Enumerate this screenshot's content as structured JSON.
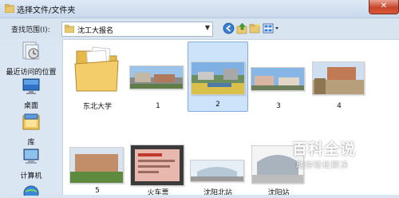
{
  "window": {
    "title": "选择文件/文件夹",
    "close_label": "✕"
  },
  "toolbar": {
    "lookin_label": "查找范围",
    "lookin_shortcut": "(I):",
    "path": "沈工大报名"
  },
  "places": [
    {
      "label": "最近访问的位置",
      "icon": "recent-places-icon"
    },
    {
      "label": "桌面",
      "icon": "desktop-icon"
    },
    {
      "label": "库",
      "icon": "libraries-icon"
    },
    {
      "label": "计算机",
      "icon": "computer-icon"
    }
  ],
  "files": [
    {
      "label": "东北大学",
      "type": "folder"
    },
    {
      "label": "1",
      "type": "image"
    },
    {
      "label": "2",
      "type": "image",
      "selected": true
    },
    {
      "label": "3",
      "type": "image"
    },
    {
      "label": "4",
      "type": "image"
    },
    {
      "label": "5",
      "type": "image"
    },
    {
      "label": "火车票",
      "type": "image"
    },
    {
      "label": "沈阳北站",
      "type": "image"
    },
    {
      "label": "沈阳站",
      "type": "image"
    }
  ],
  "watermark": {
    "logo_text": "百科全说",
    "sub_text": "助你轻松解决"
  },
  "colors": {
    "selection": "#cce3f9",
    "selection_border": "#84acdd",
    "close": "#c7452a"
  }
}
